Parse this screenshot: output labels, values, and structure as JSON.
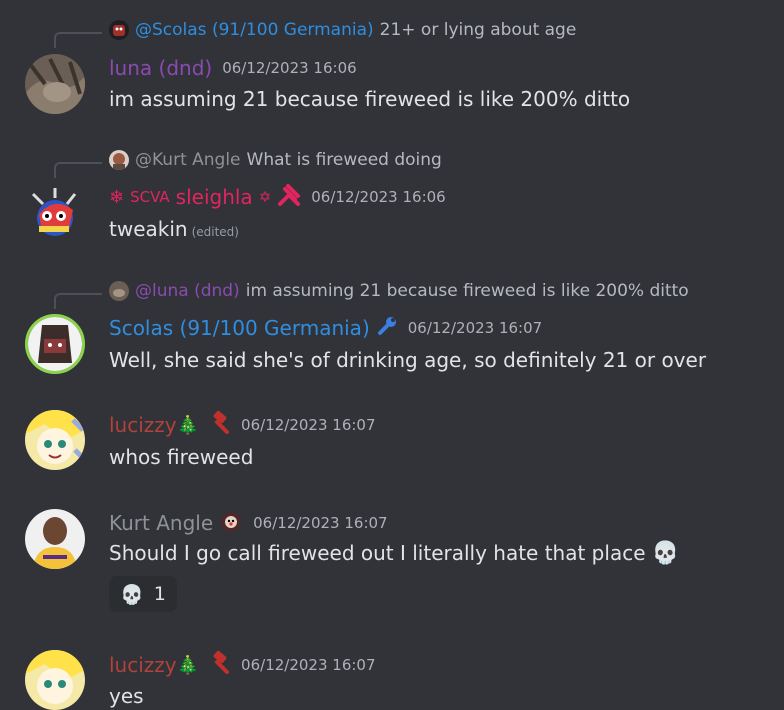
{
  "messages": [
    {
      "reply": {
        "name": "@Scolas (91/100 Germania)",
        "text": "21+ or lying about age"
      },
      "author": "luna (dnd)",
      "timestamp": "06/12/2023 16:06",
      "text": "im assuming 21 because fireweed is like 200% ditto"
    },
    {
      "reply": {
        "name": "@Kurt Angle",
        "text": "What is fireweed doing"
      },
      "author_prefix": "SCVA",
      "author": "sleighla",
      "timestamp": "06/12/2023 16:06",
      "text": "tweakin",
      "edited": "(edited)"
    },
    {
      "reply": {
        "name": "@luna (dnd)",
        "text": "im assuming 21 because fireweed is like 200% ditto"
      },
      "author": "Scolas (91/100 Germania)",
      "timestamp": "06/12/2023 16:07",
      "text": "Well, she said she's of drinking age, so definitely 21 or over"
    },
    {
      "author": "lucizzy",
      "timestamp": "06/12/2023 16:07",
      "text": "whos fireweed"
    },
    {
      "author": "Kurt Angle",
      "timestamp": "06/12/2023 16:07",
      "text": "Should I go call fireweed out I literally hate that place",
      "reaction": {
        "emoji": "skull",
        "count": "1"
      }
    },
    {
      "author": "lucizzy",
      "timestamp": "06/12/2023 16:07",
      "text": "yes"
    }
  ],
  "colors": {
    "luna": "#8a4bb0",
    "sleighla": "#e2245f",
    "scolas": "#2f8ee0",
    "lucizzy": "#b2423a",
    "kurt": "#8e9297"
  },
  "icons": {
    "tree": "🎄",
    "skull": "💀"
  }
}
